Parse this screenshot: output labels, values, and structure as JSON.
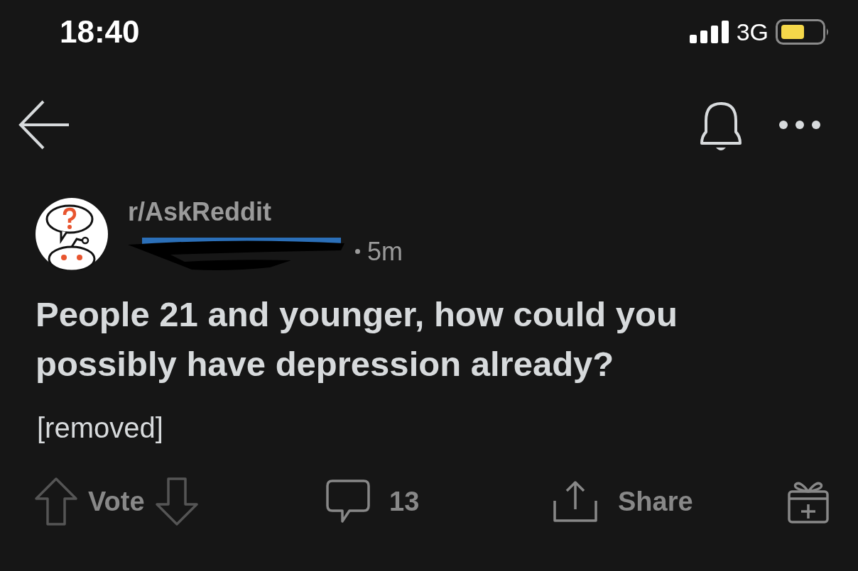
{
  "status_bar": {
    "time": "18:40",
    "network": "3G"
  },
  "post": {
    "subreddit": "r/AskReddit",
    "age": "5m",
    "title": "People 21 and younger, how could you possibly have depression already?",
    "body": "[removed]"
  },
  "actions": {
    "vote_label": "Vote",
    "comment_count": "13",
    "share_label": "Share"
  }
}
